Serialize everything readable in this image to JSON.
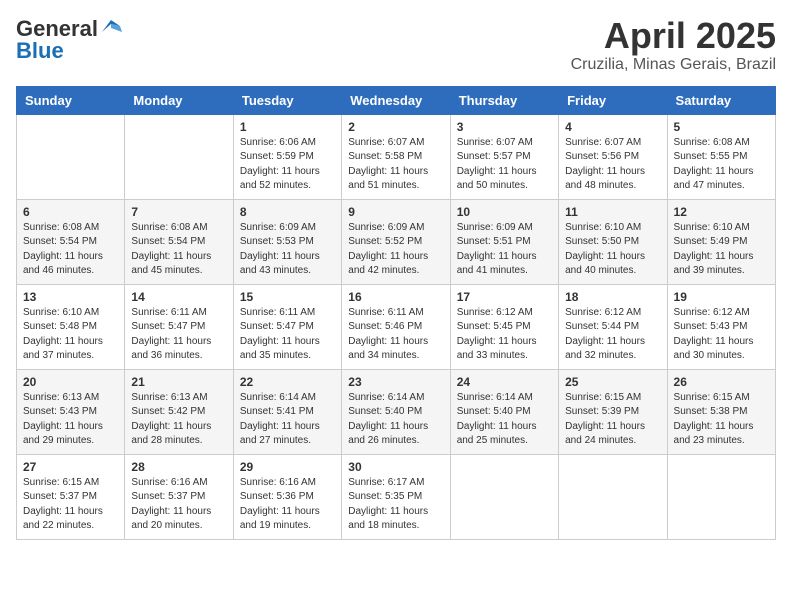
{
  "header": {
    "logo": {
      "line1": "General",
      "line2": "Blue",
      "bird_symbol": "▲"
    },
    "title": "April 2025",
    "location": "Cruzilia, Minas Gerais, Brazil"
  },
  "days_of_week": [
    "Sunday",
    "Monday",
    "Tuesday",
    "Wednesday",
    "Thursday",
    "Friday",
    "Saturday"
  ],
  "weeks": [
    [
      {
        "day": "",
        "info": ""
      },
      {
        "day": "",
        "info": ""
      },
      {
        "day": "1",
        "info": "Sunrise: 6:06 AM\nSunset: 5:59 PM\nDaylight: 11 hours and 52 minutes."
      },
      {
        "day": "2",
        "info": "Sunrise: 6:07 AM\nSunset: 5:58 PM\nDaylight: 11 hours and 51 minutes."
      },
      {
        "day": "3",
        "info": "Sunrise: 6:07 AM\nSunset: 5:57 PM\nDaylight: 11 hours and 50 minutes."
      },
      {
        "day": "4",
        "info": "Sunrise: 6:07 AM\nSunset: 5:56 PM\nDaylight: 11 hours and 48 minutes."
      },
      {
        "day": "5",
        "info": "Sunrise: 6:08 AM\nSunset: 5:55 PM\nDaylight: 11 hours and 47 minutes."
      }
    ],
    [
      {
        "day": "6",
        "info": "Sunrise: 6:08 AM\nSunset: 5:54 PM\nDaylight: 11 hours and 46 minutes."
      },
      {
        "day": "7",
        "info": "Sunrise: 6:08 AM\nSunset: 5:54 PM\nDaylight: 11 hours and 45 minutes."
      },
      {
        "day": "8",
        "info": "Sunrise: 6:09 AM\nSunset: 5:53 PM\nDaylight: 11 hours and 43 minutes."
      },
      {
        "day": "9",
        "info": "Sunrise: 6:09 AM\nSunset: 5:52 PM\nDaylight: 11 hours and 42 minutes."
      },
      {
        "day": "10",
        "info": "Sunrise: 6:09 AM\nSunset: 5:51 PM\nDaylight: 11 hours and 41 minutes."
      },
      {
        "day": "11",
        "info": "Sunrise: 6:10 AM\nSunset: 5:50 PM\nDaylight: 11 hours and 40 minutes."
      },
      {
        "day": "12",
        "info": "Sunrise: 6:10 AM\nSunset: 5:49 PM\nDaylight: 11 hours and 39 minutes."
      }
    ],
    [
      {
        "day": "13",
        "info": "Sunrise: 6:10 AM\nSunset: 5:48 PM\nDaylight: 11 hours and 37 minutes."
      },
      {
        "day": "14",
        "info": "Sunrise: 6:11 AM\nSunset: 5:47 PM\nDaylight: 11 hours and 36 minutes."
      },
      {
        "day": "15",
        "info": "Sunrise: 6:11 AM\nSunset: 5:47 PM\nDaylight: 11 hours and 35 minutes."
      },
      {
        "day": "16",
        "info": "Sunrise: 6:11 AM\nSunset: 5:46 PM\nDaylight: 11 hours and 34 minutes."
      },
      {
        "day": "17",
        "info": "Sunrise: 6:12 AM\nSunset: 5:45 PM\nDaylight: 11 hours and 33 minutes."
      },
      {
        "day": "18",
        "info": "Sunrise: 6:12 AM\nSunset: 5:44 PM\nDaylight: 11 hours and 32 minutes."
      },
      {
        "day": "19",
        "info": "Sunrise: 6:12 AM\nSunset: 5:43 PM\nDaylight: 11 hours and 30 minutes."
      }
    ],
    [
      {
        "day": "20",
        "info": "Sunrise: 6:13 AM\nSunset: 5:43 PM\nDaylight: 11 hours and 29 minutes."
      },
      {
        "day": "21",
        "info": "Sunrise: 6:13 AM\nSunset: 5:42 PM\nDaylight: 11 hours and 28 minutes."
      },
      {
        "day": "22",
        "info": "Sunrise: 6:14 AM\nSunset: 5:41 PM\nDaylight: 11 hours and 27 minutes."
      },
      {
        "day": "23",
        "info": "Sunrise: 6:14 AM\nSunset: 5:40 PM\nDaylight: 11 hours and 26 minutes."
      },
      {
        "day": "24",
        "info": "Sunrise: 6:14 AM\nSunset: 5:40 PM\nDaylight: 11 hours and 25 minutes."
      },
      {
        "day": "25",
        "info": "Sunrise: 6:15 AM\nSunset: 5:39 PM\nDaylight: 11 hours and 24 minutes."
      },
      {
        "day": "26",
        "info": "Sunrise: 6:15 AM\nSunset: 5:38 PM\nDaylight: 11 hours and 23 minutes."
      }
    ],
    [
      {
        "day": "27",
        "info": "Sunrise: 6:15 AM\nSunset: 5:37 PM\nDaylight: 11 hours and 22 minutes."
      },
      {
        "day": "28",
        "info": "Sunrise: 6:16 AM\nSunset: 5:37 PM\nDaylight: 11 hours and 20 minutes."
      },
      {
        "day": "29",
        "info": "Sunrise: 6:16 AM\nSunset: 5:36 PM\nDaylight: 11 hours and 19 minutes."
      },
      {
        "day": "30",
        "info": "Sunrise: 6:17 AM\nSunset: 5:35 PM\nDaylight: 11 hours and 18 minutes."
      },
      {
        "day": "",
        "info": ""
      },
      {
        "day": "",
        "info": ""
      },
      {
        "day": "",
        "info": ""
      }
    ]
  ]
}
